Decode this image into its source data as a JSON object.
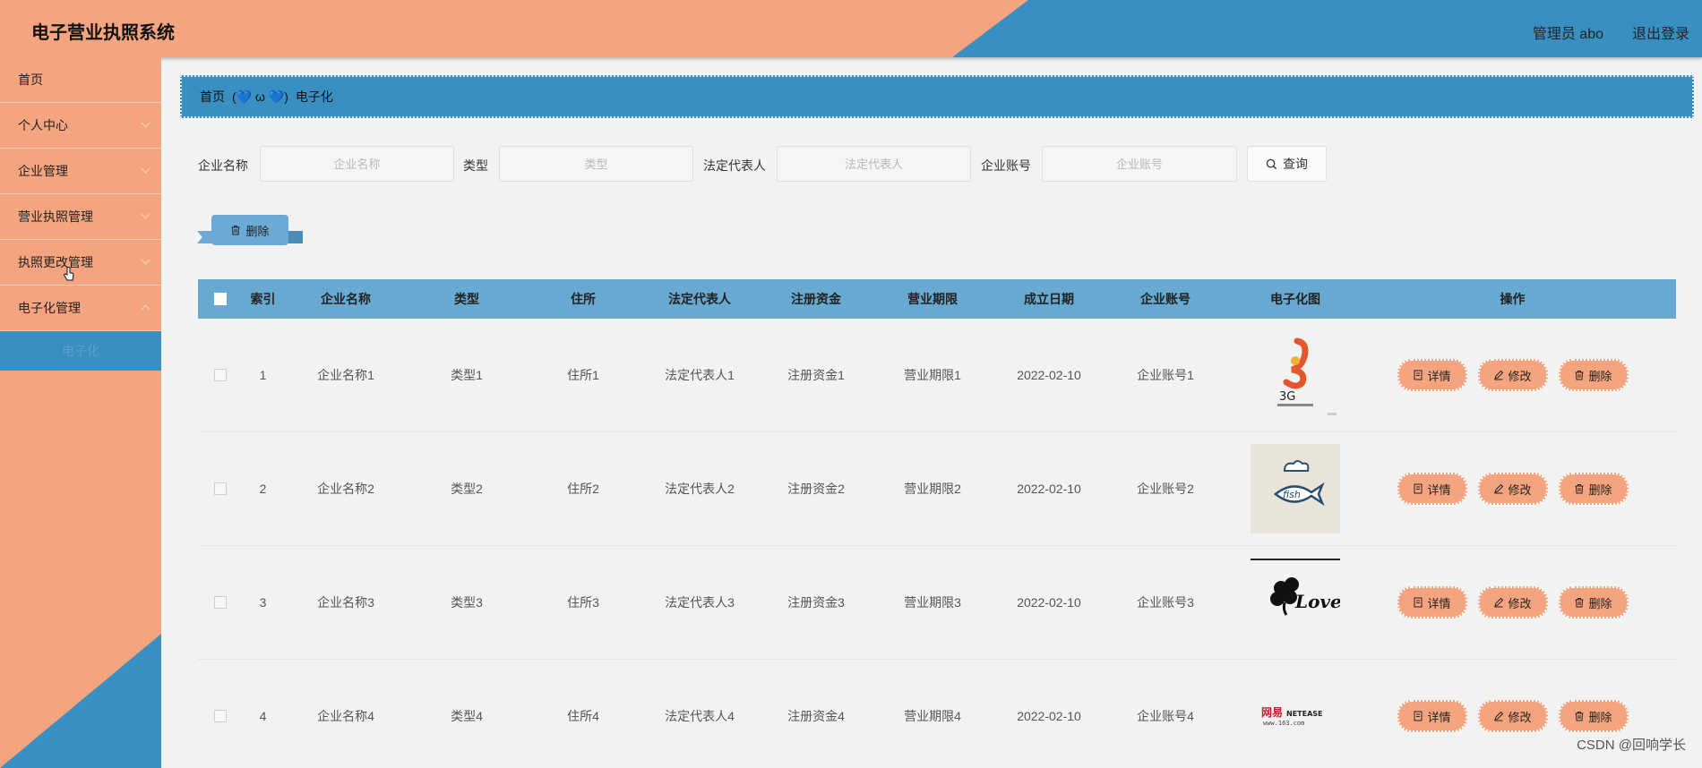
{
  "header": {
    "title": "电子营业执照系统",
    "admin": "管理员 abo",
    "logout": "退出登录"
  },
  "sidebar": {
    "items": [
      {
        "label": "首页",
        "chevron": false
      },
      {
        "label": "个人中心",
        "chevron": true
      },
      {
        "label": "企业管理",
        "chevron": true
      },
      {
        "label": "营业执照管理",
        "chevron": true
      },
      {
        "label": "执照更改管理",
        "chevron": true
      },
      {
        "label": "电子化管理",
        "chevron": true,
        "open": true
      }
    ],
    "submenu": [
      {
        "label": "电子化"
      }
    ]
  },
  "breadcrumb": {
    "home": "首页",
    "emoji": "(💙 ω 💙)",
    "current": "电子化"
  },
  "search": {
    "fields": [
      {
        "label": "企业名称",
        "placeholder": "企业名称"
      },
      {
        "label": "类型",
        "placeholder": "类型"
      },
      {
        "label": "法定代表人",
        "placeholder": "法定代表人"
      },
      {
        "label": "企业账号",
        "placeholder": "企业账号"
      }
    ],
    "button": "查询"
  },
  "actions": {
    "delete": "删除"
  },
  "table": {
    "columns": [
      "索引",
      "企业名称",
      "类型",
      "住所",
      "法定代表人",
      "注册资金",
      "营业期限",
      "成立日期",
      "企业账号",
      "电子化图",
      "操作"
    ],
    "rows": [
      {
        "index": "1",
        "name": "企业名称1",
        "type": "类型1",
        "addr": "住所1",
        "legal": "法定代表人1",
        "capital": "注册资金1",
        "term": "营业期限1",
        "date": "2022-02-10",
        "account": "企业账号1",
        "logo": "3g-logo"
      },
      {
        "index": "2",
        "name": "企业名称2",
        "type": "类型2",
        "addr": "住所2",
        "legal": "法定代表人2",
        "capital": "注册资金2",
        "term": "营业期限2",
        "date": "2022-02-10",
        "account": "企业账号2",
        "logo": "fish-logo"
      },
      {
        "index": "3",
        "name": "企业名称3",
        "type": "类型3",
        "addr": "住所3",
        "legal": "法定代表人3",
        "capital": "注册资金3",
        "term": "营业期限3",
        "date": "2022-02-10",
        "account": "企业账号3",
        "logo": "love-logo"
      },
      {
        "index": "4",
        "name": "企业名称4",
        "type": "类型4",
        "addr": "住所4",
        "legal": "法定代表人4",
        "capital": "注册资金4",
        "term": "营业期限4",
        "date": "2022-02-10",
        "account": "企业账号4",
        "logo": "netease-logo"
      }
    ],
    "ops": {
      "detail": "详情",
      "edit": "修改",
      "delete": "删除"
    }
  },
  "logos": {
    "fish_text": "fish",
    "love_text": "Love",
    "netease_cn": "网易",
    "netease_en": "NETEASE",
    "netease_url": "www.163.com"
  },
  "watermark": "CSDN @回响学长",
  "colors": {
    "salmon": "#f4a47e",
    "blue": "#3a8fc2",
    "table_header": "#67a9d1"
  }
}
